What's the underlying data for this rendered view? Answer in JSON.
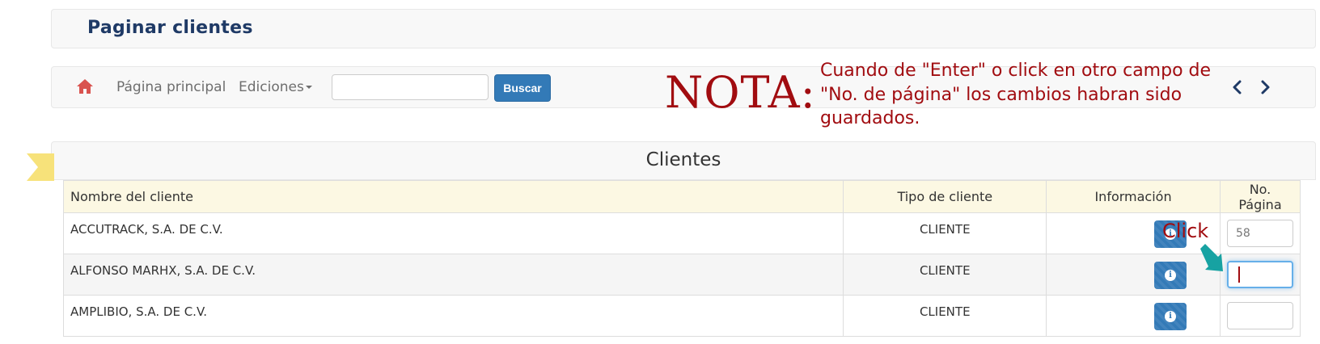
{
  "page_title": "Paginar clientes",
  "navbar": {
    "home_label": "Página principal",
    "edit_label": "Ediciones",
    "search_value": "",
    "search_button": "Buscar",
    "pager_prev_icon": "chevron-left-icon",
    "pager_next_icon": "chevron-right-icon"
  },
  "note": {
    "label": "NOTA:",
    "text": "Cuando de \"Enter\" o click en otro campo de \"No. de página\" los cambios habran sido guardados.",
    "color": "#a10c10"
  },
  "section_title": "Clientes",
  "table": {
    "headers": [
      "Nombre del cliente",
      "Tipo de cliente",
      "Información",
      "No. Página"
    ],
    "rows": [
      {
        "name": "ACCUTRACK, S.A. DE C.V.",
        "type": "CLIENTE",
        "page": "58"
      },
      {
        "name": "ALFONSO MARHX, S.A. DE C.V.",
        "type": "CLIENTE",
        "page": ""
      },
      {
        "name": "AMPLIBIO, S.A. DE C.V.",
        "type": "CLIENTE",
        "page": ""
      }
    ]
  },
  "annotation": {
    "click_label": "Click"
  },
  "colors": {
    "accent": "#337ab7",
    "header_row": "#fcf8e3",
    "title": "#1f3a66",
    "home_icon": "#d9534f",
    "arrow": "#17a2a2",
    "ribbon": "#f7e27a"
  }
}
